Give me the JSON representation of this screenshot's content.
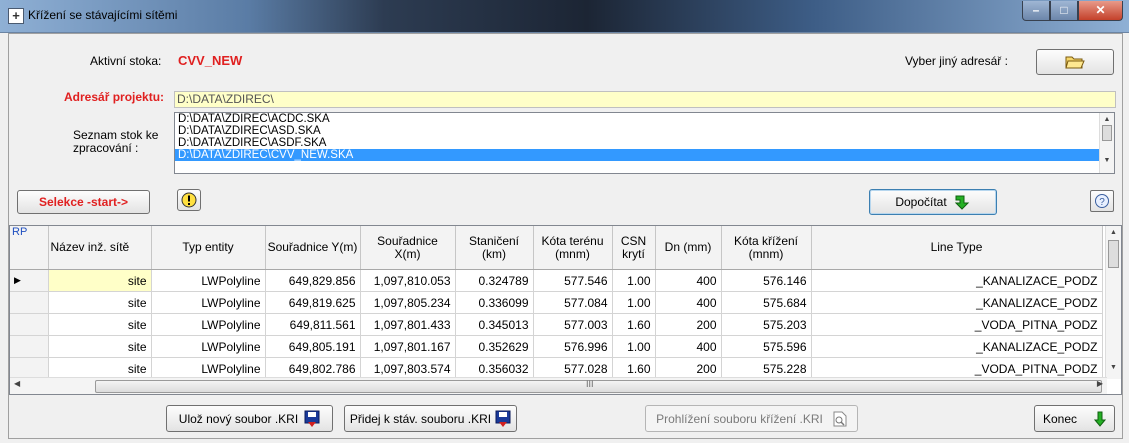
{
  "window": {
    "title": "Křížení se stávajícími sítěmi"
  },
  "active_sewer": {
    "label": "Aktivní stoka:",
    "value": "CVV_NEW"
  },
  "other_dir": {
    "label": "Vyber jiný adresář :"
  },
  "project_dir": {
    "label": "Adresář projektu:",
    "value": "D:\\DATA\\ZDIREC\\"
  },
  "sewer_list": {
    "label": "Seznam stok ke zpracování :",
    "items": [
      "D:\\DATA\\ZDIREC\\ACDC.SKA",
      "D:\\DATA\\ZDIREC\\ASD.SKA",
      "D:\\DATA\\ZDIREC\\ASDF.SKA",
      "D:\\DATA\\ZDIREC\\CVV_NEW.SKA"
    ],
    "selected_index": 3
  },
  "buttons": {
    "select_start": "Selekce -start->",
    "recalc": "Dopočítat",
    "save_new": "Ulož  nový soubor .KRI",
    "append": "Přidej k stáv. souboru .KRI",
    "view": "Prohlížení souboru křížení .KRI",
    "close": "Konec"
  },
  "grid": {
    "corner": "RP",
    "columns": [
      "Název inž. sítě",
      "Typ entity",
      "Souřadnice Y(m)",
      "Souřadnice X(m)",
      "Staničení (km)",
      "Kóta terénu (mnm)",
      "CSN krytí",
      "Dn (mm)",
      "Kóta křížení (mnm)",
      "Line Type"
    ],
    "rows": [
      [
        "site",
        "LWPolyline",
        "649,829.856",
        "1,097,810.053",
        "0.324789",
        "577.546",
        "1.00",
        "400",
        "576.146",
        "_KANALIZACE_PODZ"
      ],
      [
        "site",
        "LWPolyline",
        "649,819.625",
        "1,097,805.234",
        "0.336099",
        "577.084",
        "1.00",
        "400",
        "575.684",
        "_KANALIZACE_PODZ"
      ],
      [
        "site",
        "LWPolyline",
        "649,811.561",
        "1,097,801.433",
        "0.345013",
        "577.003",
        "1.60",
        "200",
        "575.203",
        "_VODA_PITNA_PODZ"
      ],
      [
        "site",
        "LWPolyline",
        "649,805.191",
        "1,097,801.167",
        "0.352629",
        "576.996",
        "1.00",
        "400",
        "575.596",
        "_KANALIZACE_PODZ"
      ],
      [
        "site",
        "LWPolyline",
        "649,802.786",
        "1,097,803.574",
        "0.356032",
        "577.028",
        "1.60",
        "200",
        "575.228",
        "_VODA_PITNA_PODZ"
      ]
    ],
    "current_row": 0,
    "scroll_grip": "III"
  }
}
